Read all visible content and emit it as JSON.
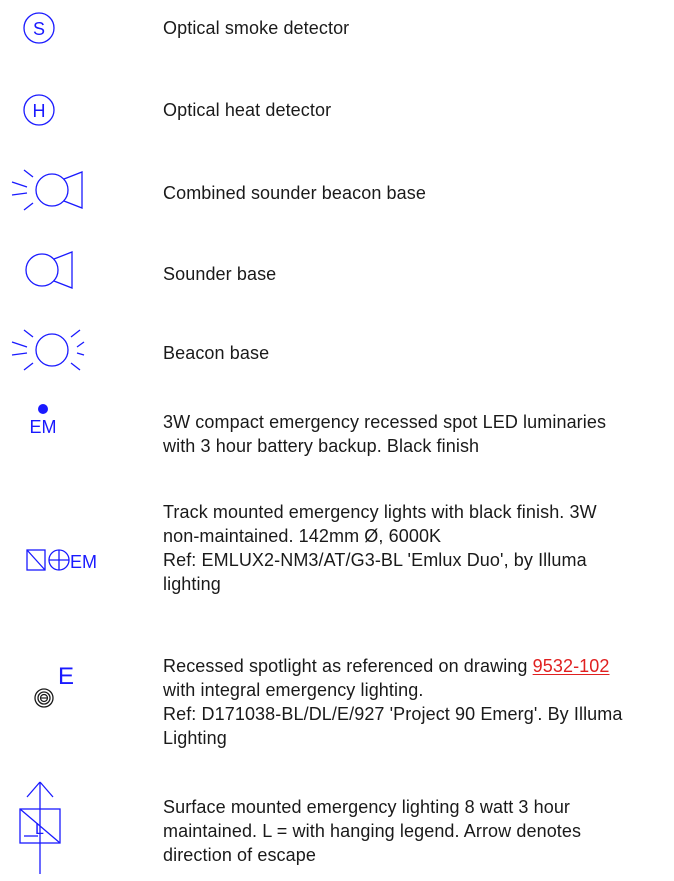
{
  "legend": {
    "items": [
      {
        "symbol": "smoke-detector",
        "symbol_letter": "S",
        "lines": [
          "Optical smoke detector"
        ]
      },
      {
        "symbol": "heat-detector",
        "symbol_letter": "H",
        "lines": [
          "Optical heat detector"
        ]
      },
      {
        "symbol": "combined-sounder-beacon",
        "lines": [
          "Combined sounder beacon base"
        ]
      },
      {
        "symbol": "sounder",
        "lines": [
          "Sounder base"
        ]
      },
      {
        "symbol": "beacon",
        "lines": [
          "Beacon base"
        ]
      },
      {
        "symbol": "emergency-spot",
        "symbol_letter": "EM",
        "lines": [
          "3W compact emergency recessed spot LED luminaries",
          "with 3 hour battery backup. Black finish"
        ]
      },
      {
        "symbol": "track-emergency",
        "symbol_letter": "EM",
        "lines": [
          "Track mounted emergency lights with black finish. 3W",
          "non-maintained. 142mm Ø, 6000K",
          "Ref: EMLUX2-NM3/AT/G3-BL 'Emlux Duo', by Illuma",
          "lighting"
        ]
      },
      {
        "symbol": "recessed-spot-emergency",
        "symbol_letter": "E",
        "line1_prefix": "Recessed spotlight as referenced on drawing ",
        "line1_link": "9532-102",
        "lines": [
          "with integral emergency lighting.",
          "Ref: D171038-BL/DL/E/927 'Project 90 Emerg'. By Illuma",
          "Lighting"
        ]
      },
      {
        "symbol": "surface-emergency-escape",
        "symbol_letter": "L",
        "lines": [
          "Surface mounted emergency lighting 8 watt 3 hour",
          "maintained. L = with hanging legend. Arrow denotes",
          "direction of escape"
        ]
      }
    ]
  },
  "colors": {
    "symbol_blue": "#1a1aff",
    "text": "#1a1a1a",
    "link_red": "#e02020"
  }
}
